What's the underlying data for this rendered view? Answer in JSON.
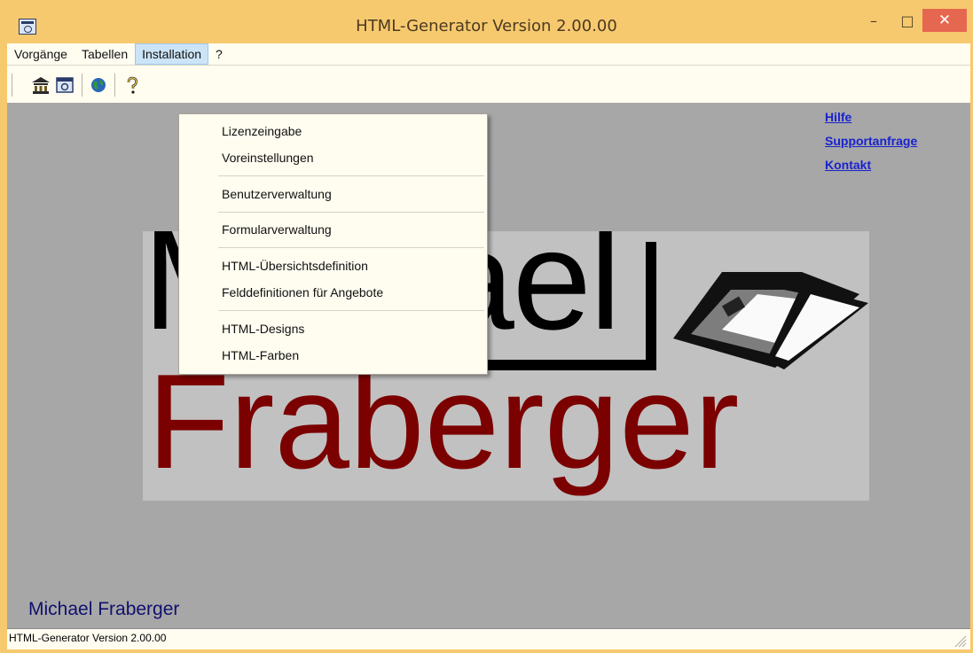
{
  "window": {
    "title": "HTML-Generator Version 2.00.00",
    "controls": {
      "minimize": "–",
      "maximize": "□",
      "close": "✕"
    }
  },
  "menubar": {
    "items": [
      "Vorgänge",
      "Tabellen",
      "Installation",
      "?"
    ],
    "active": "Installation"
  },
  "toolbar": {
    "icons": [
      "bank-icon",
      "window-icon",
      "globe-icon",
      "help-icon"
    ]
  },
  "installation_menu": {
    "items": [
      "Lizenzeingabe",
      "Voreinstellungen",
      "Benutzerverwaltung",
      "Formularverwaltung",
      "HTML-Übersichtsdefinition",
      "Felddefinitionen für Angebote",
      "HTML-Designs",
      "HTML-Farben"
    ]
  },
  "links": [
    "Hilfe",
    "Supportanfrage",
    "Kontakt"
  ],
  "logo": {
    "line1": "Michael",
    "line2": "Fraberger",
    "colors": {
      "line1": "#000000",
      "line2": "#7b0000"
    }
  },
  "footer_name": "Michael Fraberger",
  "status_text": "HTML-Generator Version 2.00.00"
}
